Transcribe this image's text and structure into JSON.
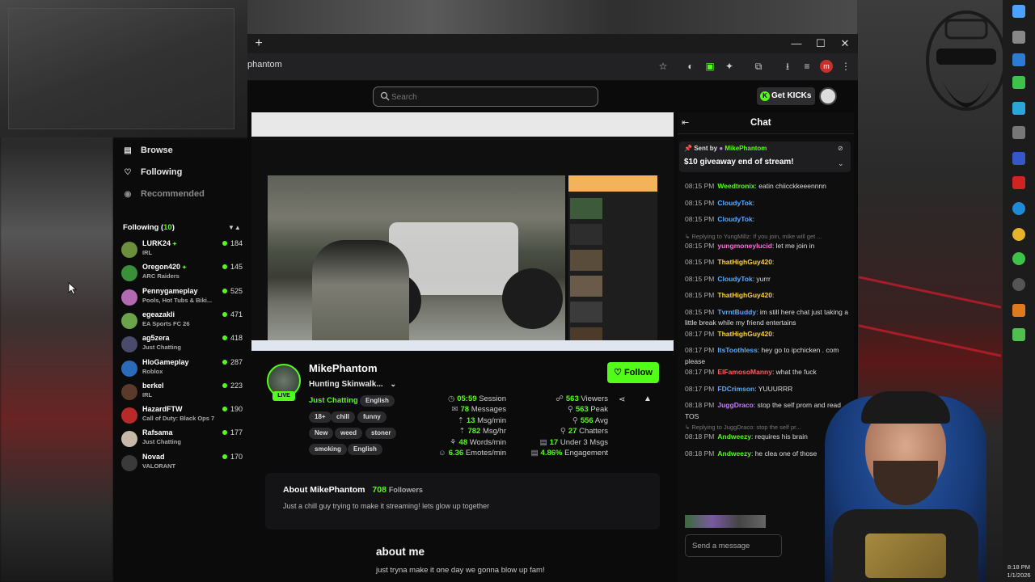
{
  "browser": {
    "url": "phantom",
    "new_tab_label": "+",
    "window_controls": [
      "—",
      "☐",
      "✕"
    ]
  },
  "header": {
    "search_placeholder": "Search",
    "get_kicks_label": "Get KICKs"
  },
  "sidebar": {
    "nav": [
      {
        "label": "Browse",
        "icon": "browse-icon"
      },
      {
        "label": "Following",
        "icon": "heart-icon"
      },
      {
        "label": "Recommended",
        "icon": "recommended-icon"
      }
    ],
    "following_label": "Following (",
    "following_count": "10",
    "following_close": ")",
    "following": [
      {
        "name": "LURK24",
        "category": "IRL",
        "viewers": "184",
        "verified": true
      },
      {
        "name": "Oregon420",
        "category": "ARC Raiders",
        "viewers": "145",
        "verified": true
      },
      {
        "name": "Pennygameplay",
        "category": "Pools, Hot Tubs & Biki...",
        "viewers": "525",
        "verified": false
      },
      {
        "name": "egeazakli",
        "category": "EA Sports FC 26",
        "viewers": "471",
        "verified": false
      },
      {
        "name": "ag5zera",
        "category": "Just Chatting",
        "viewers": "418",
        "verified": false
      },
      {
        "name": "HloGameplay",
        "category": "Roblox",
        "viewers": "287",
        "verified": false
      },
      {
        "name": "berkel",
        "category": "IRL",
        "viewers": "223",
        "verified": false
      },
      {
        "name": "HazardFTW",
        "category": "Call of Duty: Black Ops 7",
        "viewers": "190",
        "verified": false
      },
      {
        "name": "Rafsama",
        "category": "Just Chatting",
        "viewers": "177",
        "verified": false
      },
      {
        "name": "Novad",
        "category": "VALORANT",
        "viewers": "170",
        "verified": false
      }
    ]
  },
  "stream": {
    "live_label": "LIVE",
    "streamer": "MikePhantom",
    "title": "Hunting Skinwalk...",
    "category": "Just Chatting",
    "language": "English",
    "tags": [
      "18+",
      "chill",
      "funny",
      "New",
      "weed",
      "stoner",
      "smoking",
      "English"
    ],
    "follow_label": "Follow",
    "stats_left": [
      {
        "value": "05:59",
        "label": "Session"
      },
      {
        "value": "78",
        "label": "Messages"
      },
      {
        "value": "13",
        "label": "Msg/min"
      },
      {
        "value": "782",
        "label": "Msg/hr"
      },
      {
        "value": "48",
        "label": "Words/min"
      },
      {
        "value": "6.36",
        "label": "Emotes/min"
      }
    ],
    "stats_right": [
      {
        "value": "563",
        "label": "Viewers"
      },
      {
        "value": "563",
        "label": "Peak"
      },
      {
        "value": "556",
        "label": "Avg"
      },
      {
        "value": "27",
        "label": "Chatters"
      },
      {
        "value": "17",
        "label": "Under 3 Msgs"
      },
      {
        "value": "4.86%",
        "label": "Engagement"
      }
    ]
  },
  "about": {
    "title": "About MikePhantom",
    "followers_value": "708",
    "followers_label": "Followers",
    "description": "Just a chill guy trying to make it streaming! lets glow up together",
    "about_me_heading": "about me",
    "about_me_text": "just tryna make it one day we gonna blow up fam!"
  },
  "chat": {
    "title": "Chat",
    "pinned_prefix": "Sent by",
    "pinned_user": "MikePhantom",
    "pinned_message": "$10 giveaway end of stream!",
    "input_placeholder": "Send a message",
    "messages": [
      {
        "time": "08:15 PM",
        "user": "Weedtronix",
        "color": "#53fc18",
        "text": ": eatin chiicckkeeennnn"
      },
      {
        "time": "08:15 PM",
        "user": "CloudyTok",
        "color": "#5aa9ff",
        "text": ": "
      },
      {
        "time": "08:15 PM",
        "user": "CloudyTok",
        "color": "#5aa9ff",
        "text": ": "
      },
      {
        "reply": "Replying to YungMillz: If you join, mike will get ..."
      },
      {
        "time": "08:15 PM",
        "user": "yungmoneylucid",
        "color": "#ff6bd6",
        "text": ": let me join in"
      },
      {
        "time": "08:15 PM",
        "user": "ThatHighGuy420",
        "color": "#ffd23f",
        "text": ": "
      },
      {
        "time": "08:15 PM",
        "user": "CloudyTok",
        "color": "#5aa9ff",
        "text": ": yurrr"
      },
      {
        "time": "08:15 PM",
        "user": "ThatHighGuy420",
        "color": "#ffd23f",
        "text": ": "
      },
      {
        "time": "08:15 PM",
        "user": "TvrntBuddy",
        "color": "#5aa9ff",
        "text": ": im still here chat just taking a little break while my friend entertains"
      },
      {
        "time": "08:17 PM",
        "user": "ThatHighGuy420",
        "color": "#ffd23f",
        "text": ": "
      },
      {
        "time": "08:17 PM",
        "user": "ItsToothless",
        "color": "#5aa9ff",
        "text": ": hey go to ipchicken . com please"
      },
      {
        "time": "08:17 PM",
        "user": "ElFamosoManny",
        "color": "#ff5b5b",
        "text": ": what the fuck"
      },
      {
        "time": "08:17 PM",
        "user": "FDCrimson",
        "color": "#5aa9ff",
        "text": ": YUUURRR"
      },
      {
        "time": "08:18 PM",
        "user": "JuggDraco",
        "color": "#c87dff",
        "text": ": stop the self prom and read TOS"
      },
      {
        "reply": "Replying to JuggDraco: stop the self pr..."
      },
      {
        "time": "08:18 PM",
        "user": "Andweezy",
        "color": "#53fc18",
        "text": ": requires his brain"
      },
      {
        "time": "08:18 PM",
        "user": "Andweezy",
        "color": "#53fc18",
        "text": ": he clea one of those"
      }
    ]
  },
  "taskbar": {
    "time": "8:18 PM",
    "date": "1/1/2026"
  }
}
